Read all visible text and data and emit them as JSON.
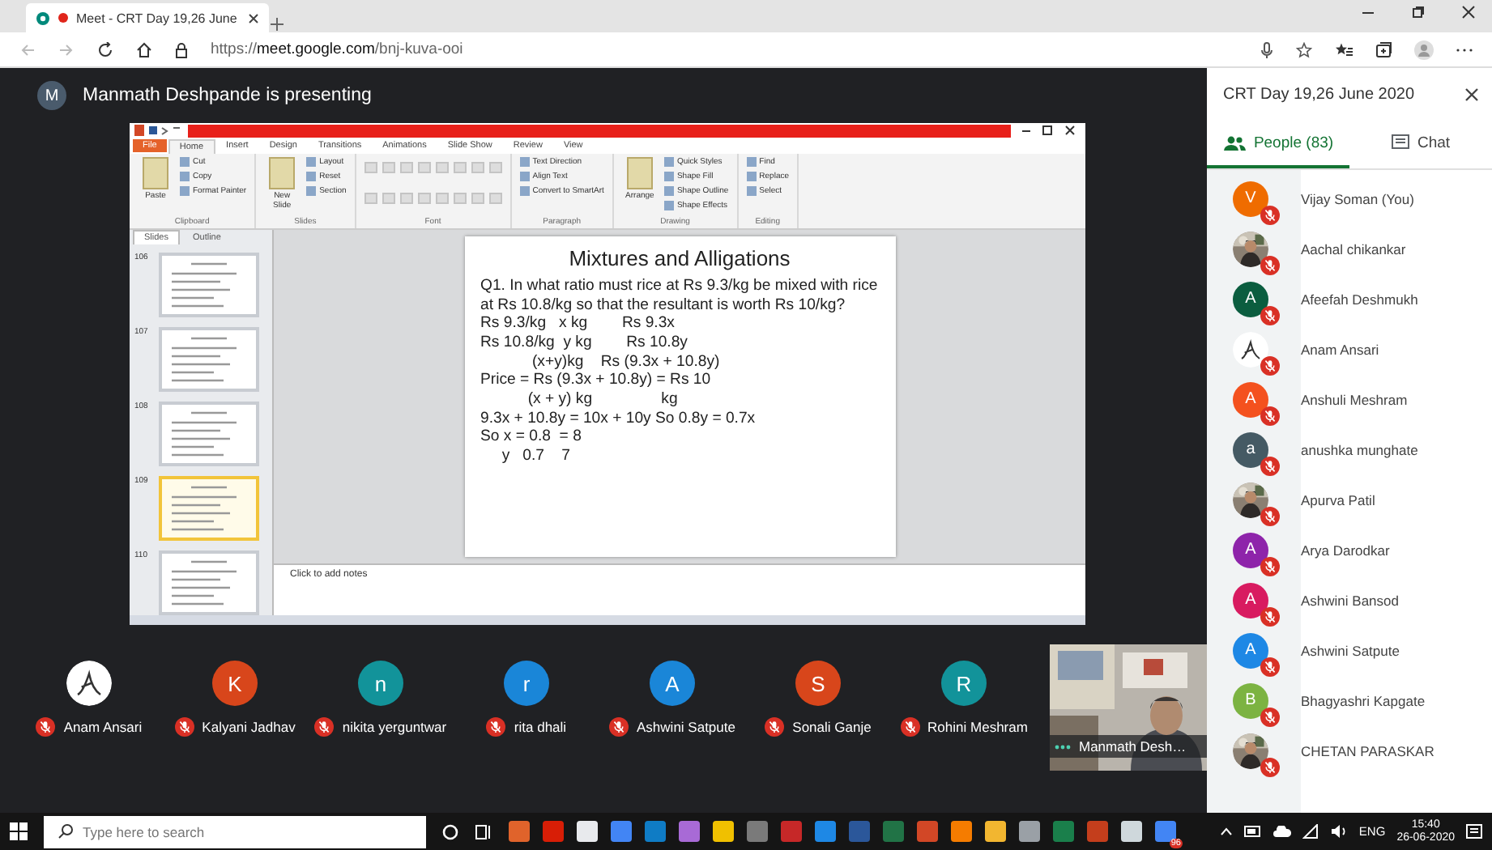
{
  "browser": {
    "tab": {
      "title": "Meet - CRT Day 19,26 June",
      "recording": true
    },
    "url": "https://**meet.google.com**/bnj-kuva-ooi"
  },
  "meet": {
    "presenter_initial": "M",
    "presenting_text": "Manmath Deshpande is presenting"
  },
  "powerpoint": {
    "ribbon_tabs": [
      {
        "label": "File",
        "kind": "file",
        "selected": false
      },
      {
        "label": "Home",
        "kind": "tab",
        "selected": true
      },
      {
        "label": "Insert",
        "kind": "tab",
        "selected": false
      },
      {
        "label": "Design",
        "kind": "tab",
        "selected": false
      },
      {
        "label": "Transitions",
        "kind": "tab",
        "selected": false
      },
      {
        "label": "Animations",
        "kind": "tab",
        "selected": false
      },
      {
        "label": "Slide Show",
        "kind": "tab",
        "selected": false
      },
      {
        "label": "Review",
        "kind": "tab",
        "selected": false
      },
      {
        "label": "View",
        "kind": "tab",
        "selected": false
      }
    ],
    "groups": [
      {
        "label": "Clipboard",
        "big": "Paste",
        "items": [
          "Cut",
          "Copy",
          "Format Painter"
        ]
      },
      {
        "label": "Slides",
        "big": "New Slide",
        "items": [
          "Layout",
          "Reset",
          "Section"
        ]
      },
      {
        "label": "Font"
      },
      {
        "label": "Paragraph",
        "items": [
          "Text Direction",
          "Align Text",
          "Convert to SmartArt"
        ]
      },
      {
        "label": "Drawing",
        "big": "Arrange",
        "items": [
          "Quick Styles",
          "Shape Fill",
          "Shape Outline",
          "Shape Effects"
        ]
      },
      {
        "label": "Editing",
        "items": [
          "Find",
          "Replace",
          "Select"
        ]
      }
    ],
    "pane_tabs": [
      {
        "label": "Slides",
        "selected": true
      },
      {
        "label": "Outline",
        "selected": false
      }
    ],
    "thumbnails": [
      {
        "number": "106",
        "selected": false
      },
      {
        "number": "107",
        "selected": false
      },
      {
        "number": "108",
        "selected": false
      },
      {
        "number": "109",
        "selected": true
      },
      {
        "number": "110",
        "selected": false
      }
    ],
    "slide": {
      "title": "Mixtures and Alligations",
      "lines": [
        {
          "kind": "paragraph",
          "text": "Q1. In what ratio must rice at Rs 9.3/kg be mixed with rice at Rs 10.8/kg so that the resultant is worth Rs 10/kg?"
        },
        {
          "kind": "pre",
          "text": "Rs 9.3/kg   x kg        Rs 9.3x"
        },
        {
          "kind": "pre",
          "text": "Rs 10.8/kg  y kg        Rs 10.8y"
        },
        {
          "kind": "pre",
          "text": "            (x+y)kg    Rs (9.3x + 10.8y)"
        },
        {
          "kind": "pre",
          "text": "Price = Rs (9.3x + 10.8y) = Rs 10"
        },
        {
          "kind": "pre",
          "text": "           (x + y) kg                kg"
        },
        {
          "kind": "pre",
          "text": "9.3x + 10.8y = 10x + 10y So 0.8y = 0.7x"
        },
        {
          "kind": "pre",
          "text": "So x = 0.8  = 8"
        },
        {
          "kind": "pre",
          "text": "     y   0.7    7"
        }
      ]
    },
    "notes_placeholder": "Click to add notes"
  },
  "strip": [
    {
      "name": "Anam Ansari",
      "kind": "drawing",
      "muted": true
    },
    {
      "name": "Kalyani Jadhav",
      "kind": "letter",
      "initial": "K",
      "color": "#d8461b",
      "muted": true
    },
    {
      "name": "nikita yerguntwar",
      "kind": "letter",
      "initial": "n",
      "color": "#12939a",
      "muted": true
    },
    {
      "name": "rita dhali",
      "kind": "letter",
      "initial": "r",
      "color": "#1a86d8",
      "muted": true
    },
    {
      "name": "Ashwini Satpute",
      "kind": "letter",
      "initial": "A",
      "color": "#1a86d8",
      "muted": true
    },
    {
      "name": "Sonali Ganje",
      "kind": "letter",
      "initial": "S",
      "color": "#d8461b",
      "muted": true
    },
    {
      "name": "Rohini Meshram",
      "kind": "letter",
      "initial": "R",
      "color": "#12939a",
      "muted": true
    }
  ],
  "presenter_tile": {
    "name": "Manmath Desh…"
  },
  "panel": {
    "title": "CRT Day 19,26 June 2020",
    "tabs": [
      {
        "label": "People (83)",
        "kind": "people",
        "selected": true
      },
      {
        "label": "Chat",
        "kind": "chat",
        "selected": false
      }
    ],
    "people": [
      {
        "name": "Vijay Soman (You)",
        "kind": "letter",
        "initial": "V",
        "color": "#ef6c00",
        "muted": true
      },
      {
        "name": "Aachal chikankar",
        "muted": true
      },
      {
        "name": "Afeefah Deshmukh",
        "kind": "letter",
        "initial": "A",
        "color": "#0b5d3f",
        "muted": true
      },
      {
        "name": "Anam Ansari",
        "kind": "drawing",
        "muted": true
      },
      {
        "name": "Anshuli Meshram",
        "kind": "letter",
        "initial": "A",
        "color": "#f4511e",
        "muted": true
      },
      {
        "name": "anushka munghate",
        "kind": "letter",
        "initial": "a",
        "color": "#455a64",
        "muted": true
      },
      {
        "name": "Apurva Patil",
        "muted": true
      },
      {
        "name": "Arya Darodkar",
        "kind": "letter",
        "initial": "A",
        "color": "#8e24aa",
        "muted": true
      },
      {
        "name": "Ashwini Bansod",
        "kind": "letter",
        "initial": "A",
        "color": "#d81b60",
        "muted": true
      },
      {
        "name": "Ashwini Satpute",
        "kind": "letter",
        "initial": "A",
        "color": "#1e88e5",
        "muted": true
      },
      {
        "name": "Bhagyashri Kapgate",
        "kind": "letter",
        "initial": "B",
        "color": "#7cb342",
        "muted": true
      },
      {
        "name": "CHETAN PARASKAR",
        "muted": true
      }
    ]
  },
  "taskbar": {
    "search_placeholder": "Type here to search",
    "badge": "96",
    "language": "ENG",
    "time": "15:40",
    "date": "26-06-2020"
  }
}
